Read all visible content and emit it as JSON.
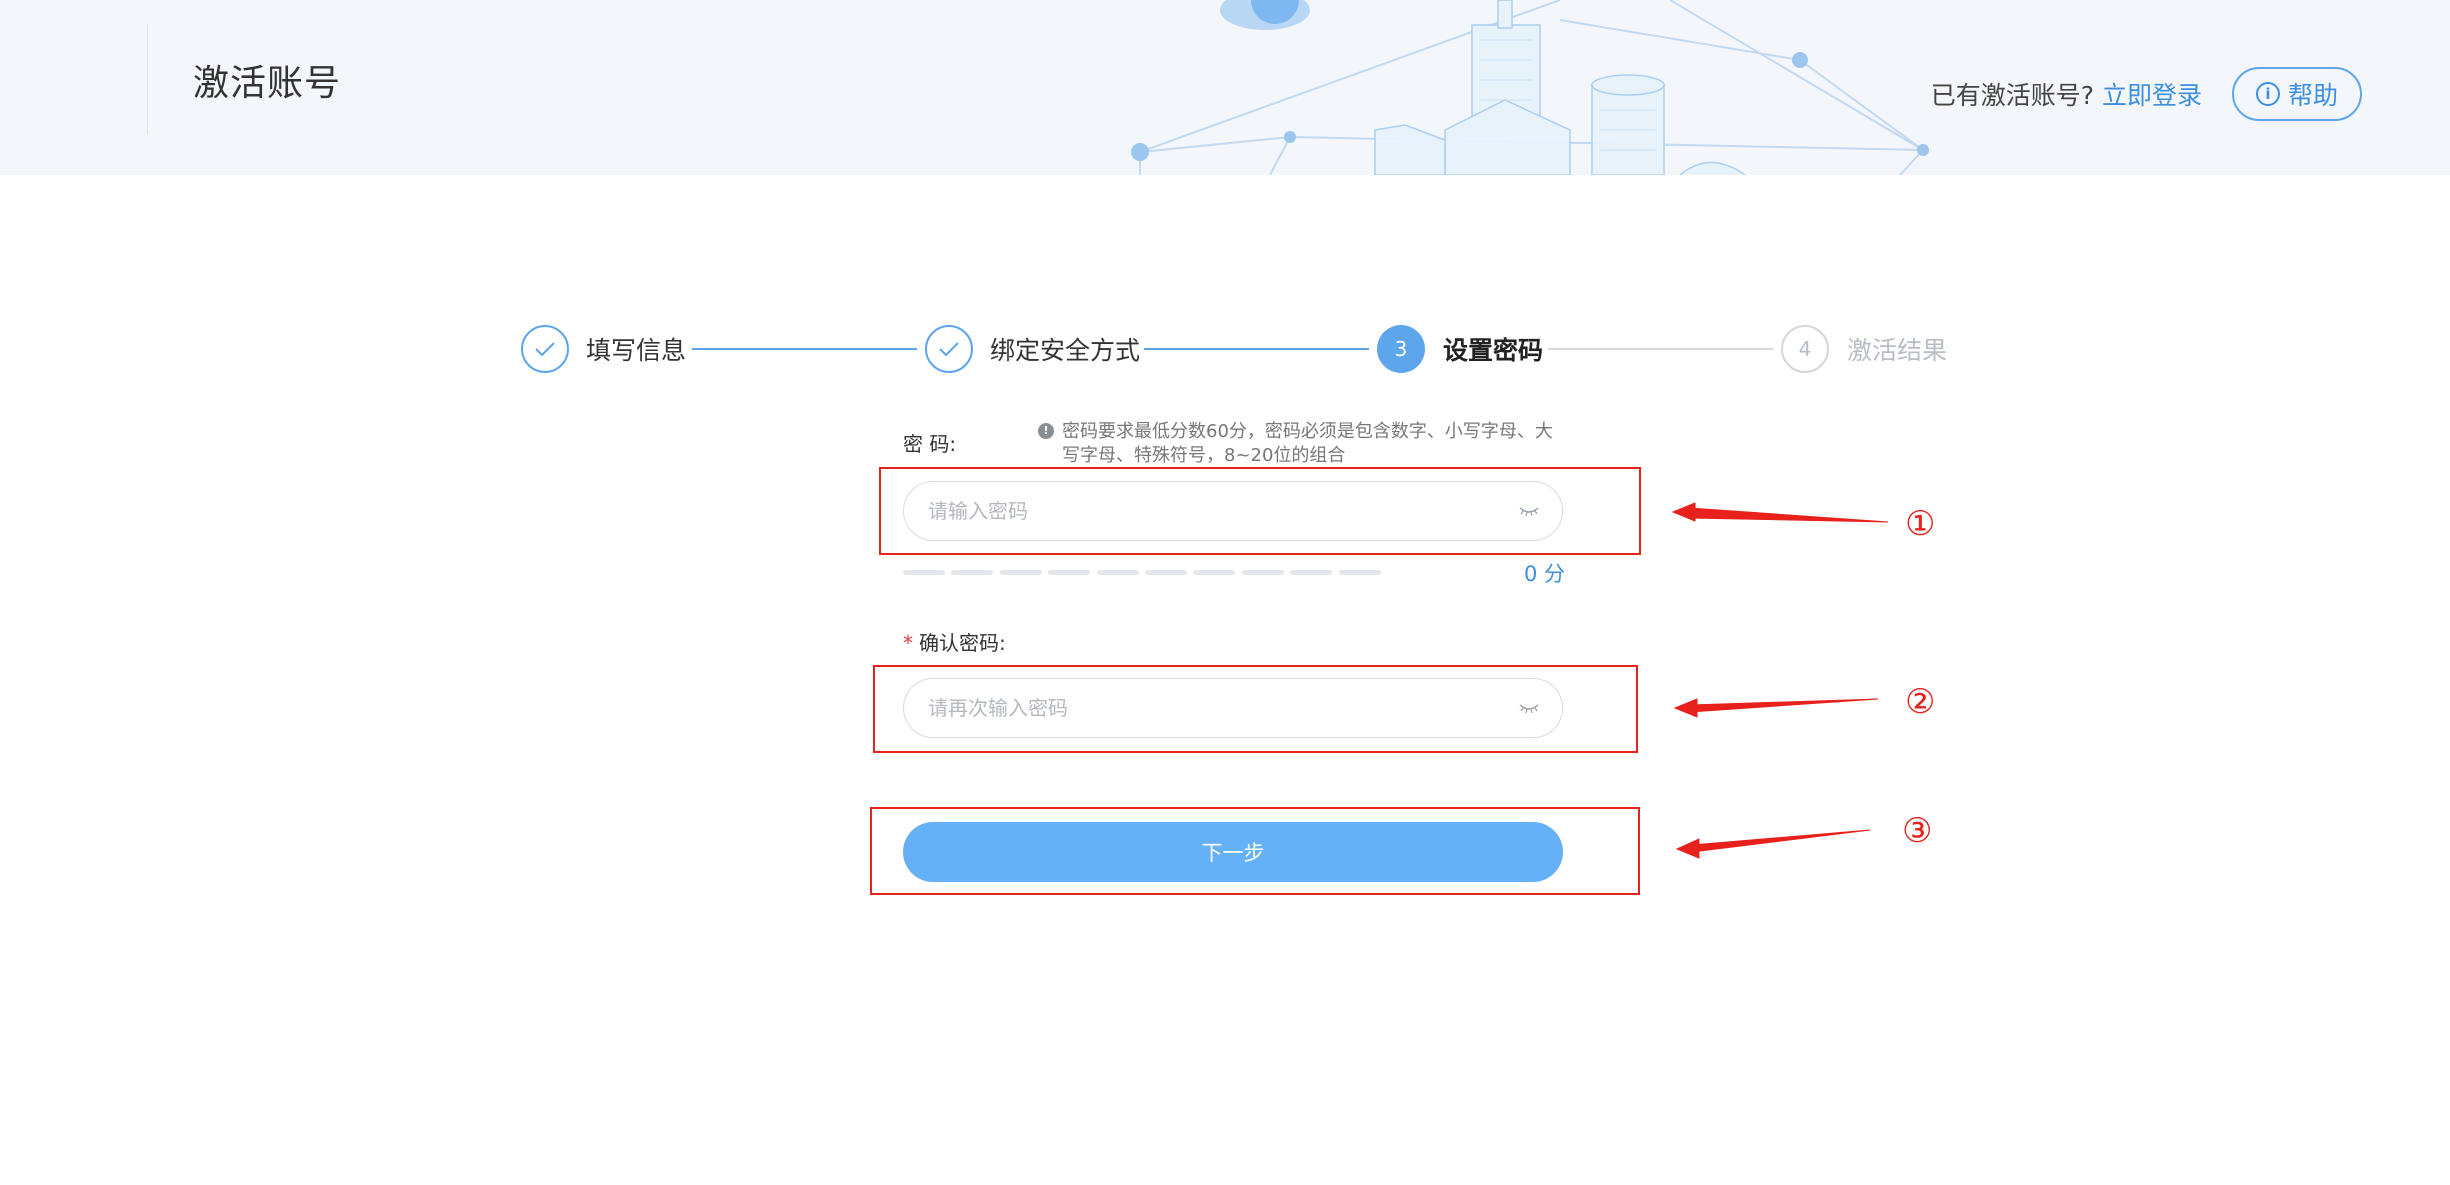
{
  "header": {
    "title": "激活账号",
    "has_account_text": "已有激活账号?",
    "login_link": "立即登录",
    "help_button": "帮助",
    "help_icon": "info-icon"
  },
  "steps": [
    {
      "label": "填写信息",
      "state": "done",
      "icon": "check-icon"
    },
    {
      "label": "绑定安全方式",
      "state": "done",
      "icon": "check-icon"
    },
    {
      "label": "设置密码",
      "state": "active",
      "number": "3"
    },
    {
      "label": "激活结果",
      "state": "todo",
      "number": "4"
    }
  ],
  "form": {
    "password_label": "密 码:",
    "password_hint": "密码要求最低分数60分，密码必须是包含数字、小写字母、大写字母、特殊符号，8~20位的组合",
    "password_placeholder": "请输入密码",
    "strength_segments": 10,
    "strength_filled": 0,
    "score_text": "0 分",
    "confirm_star": "*",
    "confirm_label": "确认密码:",
    "confirm_placeholder": "请再次输入密码",
    "next_button": "下一步"
  },
  "annotations": [
    {
      "number": "①"
    },
    {
      "number": "②"
    },
    {
      "number": "③"
    }
  ],
  "colors": {
    "primary": "#5ea6ec",
    "link": "#3d8fe0",
    "button": "#65b0f7",
    "annotation": "#e8211c",
    "header_bg": "#f3f6fa"
  }
}
